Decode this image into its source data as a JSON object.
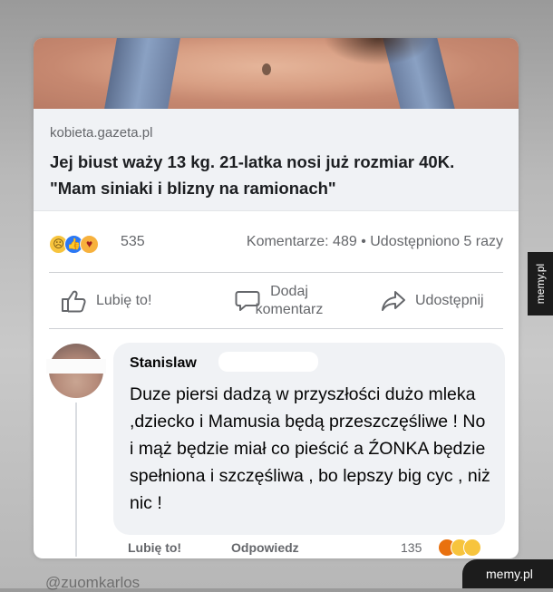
{
  "post": {
    "source_domain": "kobieta.gazeta.pl",
    "headline": "Jej biust waży 13 kg. 21-latka nosi już rozmiar 40K. \"Mam siniaki i blizny na ramionach\"",
    "reaction_count": "535",
    "stats": "Komentarze: 489 • Udostępniono 5 razy",
    "actions": {
      "like": "Lubię to!",
      "comment": "Dodaj komentarz",
      "share": "Udostępnij"
    }
  },
  "comment": {
    "author": "Stanislaw",
    "body": "Duze piersi dadzą w przyszłości dużo mleka ,dziecko i Mamusia będą przeszczęśliwe ! No i mąż będzie miał co pieścić a ŹONKA będzie spełniona i szczęśliwa , bo lepszy big cyc , niż nic !",
    "sub_like": "Lubię to!",
    "sub_reply": "Odpowiedz",
    "sub_reaction_count": "135"
  },
  "watermark": {
    "side": "memy.pl",
    "bottom": "memy.pl",
    "handle": "@zuomkarlos"
  },
  "colors": {
    "facebook_blue": "#2a78f5",
    "muted_text": "#65676b",
    "bubble_bg": "#f0f2f5"
  },
  "icons": [
    "sad-reaction-icon",
    "like-reaction-icon",
    "care-reaction-icon",
    "thumbs-up-icon",
    "comment-icon",
    "share-icon"
  ]
}
